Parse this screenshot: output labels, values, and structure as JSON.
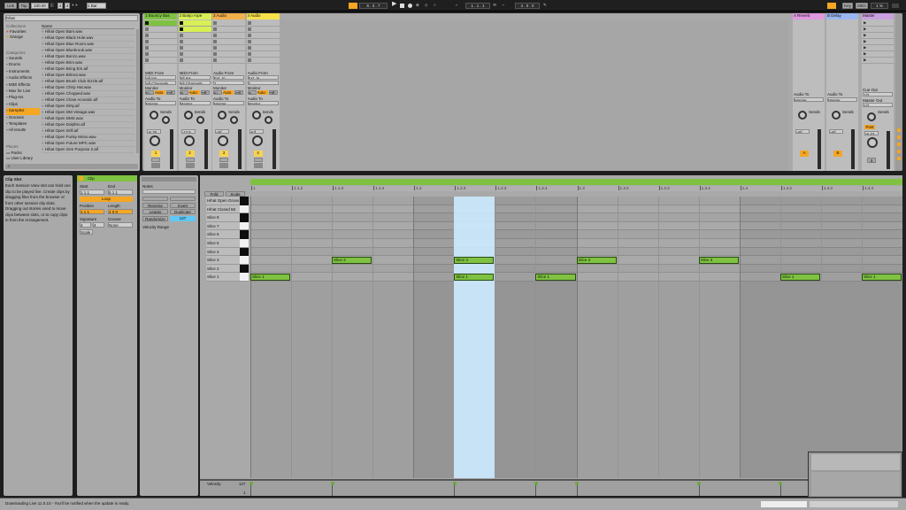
{
  "transport": {
    "link": "Link",
    "tap": "Tap",
    "tempo": "100.00",
    "meter_num": "4",
    "meter_den": "4",
    "quant": "1 Bar",
    "position": "6 . 3 . 7",
    "loop_start": "1 . 1 . 1",
    "loop_len": "4 . 0 . 0",
    "key": "Key",
    "midi": "MIDI",
    "cpu": "1 %"
  },
  "browser": {
    "search": "hihat",
    "collections_header": "Collections",
    "collections": [
      "Favorites",
      "Orange"
    ],
    "categories_header": "Categories",
    "categories": [
      "Sounds",
      "Drums",
      "Instruments",
      "Audio Effects",
      "MIDI Effects",
      "Max for Live",
      "Plug-Ins",
      "Clips",
      "Samples",
      "Grooves",
      "Templates",
      "All results"
    ],
    "places_header": "Places",
    "places": [
      "Packs",
      "User Library"
    ],
    "name_header": "Name",
    "files": [
      "Hihat Open Bam.wav",
      "Hihat Open Black Hole.wav",
      "Hihat Open Blue Room.wav",
      "Hihat Open Bluebrook.wav",
      "Hihat Open Bonzo.wav",
      "Hihat Open Brim.wav",
      "Hihat Open Bring Em.aif",
      "Hihat Open Britnot.wav",
      "Hihat Open Brush Club Sizzle.aif",
      "Hihat Open Chirp Hat.wav",
      "Hihat Open Chopped.wav",
      "Hihat Open Close Acoustic.aif",
      "Hihat Open Dirty.aif",
      "Hihat Open DM Vintage.wav",
      "Hihat Open DMX.wav",
      "Hihat Open Dolphin.aif",
      "Hihat Open Drill.aif",
      "Hihat Open Funky Mono.wav",
      "Hihat Open Future MPC.wav",
      "Hihat Open Gen Purpose 2.aif"
    ]
  },
  "tracks": [
    {
      "name": "1 Bouncy Bas",
      "color": "#7fc242",
      "num": "1",
      "midi_from": "All Ins",
      "channels": "All Channels",
      "monitor_in": "In",
      "monitor_auto": "Auto",
      "monitor_off": "Off",
      "audio_to": "Audio To",
      "master": "Master",
      "sends": "Sends",
      "volume": "-6.30"
    },
    {
      "name": "2 Banjo Arpe",
      "color": "#d9f055",
      "num": "2",
      "midi_from": "All Ins",
      "channels": "All Channels",
      "monitor_in": "In",
      "monitor_auto": "Auto",
      "monitor_off": "Off",
      "audio_to": "Audio To",
      "master": "Master",
      "sends": "Sends",
      "volume": "-13.5"
    },
    {
      "name": "3 Audio",
      "color": "#f2b04a",
      "num": "3",
      "midi_from": "Ext. In",
      "channels": "1",
      "monitor_in": "In",
      "monitor_auto": "Auto",
      "monitor_off": "Off",
      "audio_to": "Audio To",
      "master": "Master",
      "sends": "Sends",
      "volume": "-Inf"
    },
    {
      "name": "4 Audio",
      "color": "#f8e04a",
      "num": "4",
      "midi_from": "Ext. In",
      "channels": "2",
      "monitor_in": "In",
      "monitor_auto": "Auto",
      "monitor_off": "Off",
      "audio_to": "Audio To",
      "master": "Master",
      "sends": "Sends",
      "volume": "-Inf"
    }
  ],
  "midi_from_label": "MIDI From",
  "audio_from_label": "Audio From",
  "monitor_label": "Monitor",
  "drop_text": "Drop Files and Devices Here",
  "returns": [
    {
      "name": "A Reverb",
      "color": "#e098e0",
      "letter": "A",
      "audio_to": "Audio To",
      "master": "Master",
      "sends": "Sends",
      "volume": "-Inf"
    },
    {
      "name": "B Delay",
      "color": "#9ab6f0",
      "letter": "B",
      "audio_to": "Audio To",
      "master": "Master",
      "sends": "Sends",
      "volume": "-Inf"
    }
  ],
  "master": {
    "name": "Master",
    "color": "#c9a0e0",
    "cue_out": "Cue Out",
    "cue_val": "1/2",
    "master_out": "Master Out",
    "master_val": "1/2",
    "sends": "Sends",
    "post": "Post",
    "volume": "-6.43",
    "solo": "S"
  },
  "info": {
    "title": "Clip Slot",
    "body": "Each Session View slot can hold one clip to be played live. Create clips by dragging files from the browser or from other session clip slots. Dragging out stories used to move clips between slots, or to copy clips in from the Arrangement."
  },
  "clip_panel": {
    "title": "Clip",
    "start": "Start",
    "end": "End",
    "start_val": "1 1 1",
    "end_val": "5 1 1",
    "loop": "Loop",
    "position": "Position",
    "length": "Length",
    "pos_val": "1 1 1",
    "len_val": "4 0 0",
    "signature": "Signature",
    "groove": "Groove",
    "sig_num": "4",
    "sig_den": "4",
    "groove_val": "None",
    "scale": "Scale"
  },
  "notes_panel": {
    "title": "Notes",
    "reverse": "Reverse",
    "invert": "Invert",
    "legato": "Legato",
    "duplicate": "Duplicate",
    "randomize": "Randomize",
    "rand_val": "127",
    "velocity_range": "Velocity Range",
    "fold": "Fold",
    "scale": "Scale"
  },
  "ruler": [
    "1",
    "1.1.2",
    "1.1.3",
    "1.1.4",
    "1.2",
    "1.2.2",
    "1.2.3",
    "1.2.4",
    "1.3",
    "1.3.2",
    "1.3.3",
    "1.3.4",
    "1.4",
    "1.4.2",
    "1.4.3",
    "1.4.4"
  ],
  "lanes": [
    "Hihat Open Groov",
    "Hihat Closed 58",
    "Slice 8",
    "Slice 7",
    "Slice 6",
    "Slice 5",
    "Slice 4",
    "Slice 3",
    "Slice 2",
    "Slice 1"
  ],
  "notes": [
    {
      "lane": "Slice 3",
      "label": "Slice 3",
      "start": 2.0,
      "len": 0.5
    },
    {
      "lane": "Slice 3",
      "label": "Slice 3",
      "start": 5.0,
      "len": 0.5
    },
    {
      "lane": "Slice 3",
      "label": "Slice 3",
      "start": 8.0,
      "len": 0.5
    },
    {
      "lane": "Slice 3",
      "label": "Slice 3",
      "start": 11.0,
      "len": 0.5
    },
    {
      "lane": "Slice 1",
      "label": "Slice 1",
      "start": 0.0,
      "len": 0.5
    },
    {
      "lane": "Slice 1",
      "label": "Slice 1",
      "start": 5.0,
      "len": 0.5
    },
    {
      "lane": "Slice 1",
      "label": "Slice 1",
      "start": 7.0,
      "len": 0.5
    },
    {
      "lane": "Slice 1",
      "label": "Slice 1",
      "start": 13.0,
      "len": 0.5
    },
    {
      "lane": "Slice 1",
      "label": "Slice 1",
      "start": 15.0,
      "len": 0.5
    }
  ],
  "velocity": {
    "label": "Velocity",
    "max": "127",
    "min": "1"
  },
  "status": "Downloading Live 11.0.10 - You'll be notified when the update is ready."
}
